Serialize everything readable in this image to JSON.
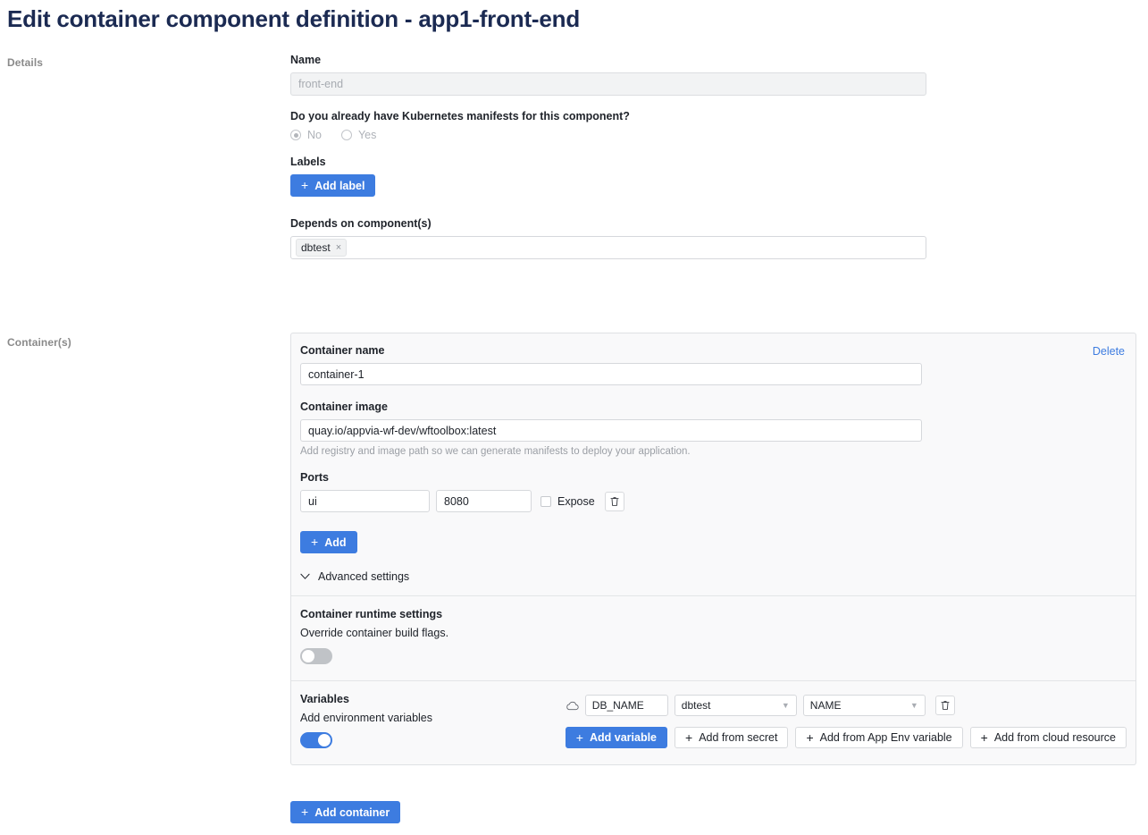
{
  "page": {
    "title": "Edit container component definition - app1-front-end",
    "accent_color": "#3d7ce0",
    "title_color": "#1b2a52"
  },
  "rail": {
    "details_label": "Details",
    "containers_label": "Container(s)"
  },
  "details": {
    "name": {
      "label": "Name",
      "value": "",
      "placeholder": "front-end",
      "disabled": true
    },
    "manifests_question": {
      "label": "Do you already have Kubernetes manifests for this component?",
      "options": [
        {
          "label": "No",
          "selected": true
        },
        {
          "label": "Yes",
          "selected": false
        }
      ]
    },
    "labels": {
      "label": "Labels",
      "add_button": "Add label"
    },
    "depends_on": {
      "label": "Depends on component(s)",
      "chips": [
        {
          "text": "dbtest",
          "remove": "×"
        }
      ]
    }
  },
  "container": {
    "delete_link": "Delete",
    "name": {
      "label": "Container name",
      "value": "container-1"
    },
    "image": {
      "label": "Container image",
      "value": "quay.io/appvia-wf-dev/wftoolbox:latest",
      "helper": "Add registry and image path so we can generate manifests to deploy your application."
    },
    "ports": {
      "label": "Ports",
      "rows": [
        {
          "name": "ui",
          "number": "8080",
          "expose_label": "Expose",
          "expose_checked": false
        }
      ],
      "add_button": "Add"
    },
    "advanced_settings": {
      "label": "Advanced settings",
      "expanded": false
    },
    "runtime": {
      "title": "Container runtime settings",
      "description": "Override container build flags.",
      "enabled": false
    },
    "variables": {
      "title": "Variables",
      "description": "Add environment variables",
      "enabled": true,
      "rows": [
        {
          "source_icon": "cloud-icon",
          "key": "DB_NAME",
          "resource": "dbtest",
          "resource_key": "NAME"
        }
      ],
      "buttons": [
        {
          "label": "Add variable",
          "primary": true
        },
        {
          "label": "Add from secret",
          "primary": false
        },
        {
          "label": "Add from App Env variable",
          "primary": false
        },
        {
          "label": "Add from cloud resource",
          "primary": false
        }
      ]
    }
  },
  "footer": {
    "add_container_button": "Add container"
  }
}
